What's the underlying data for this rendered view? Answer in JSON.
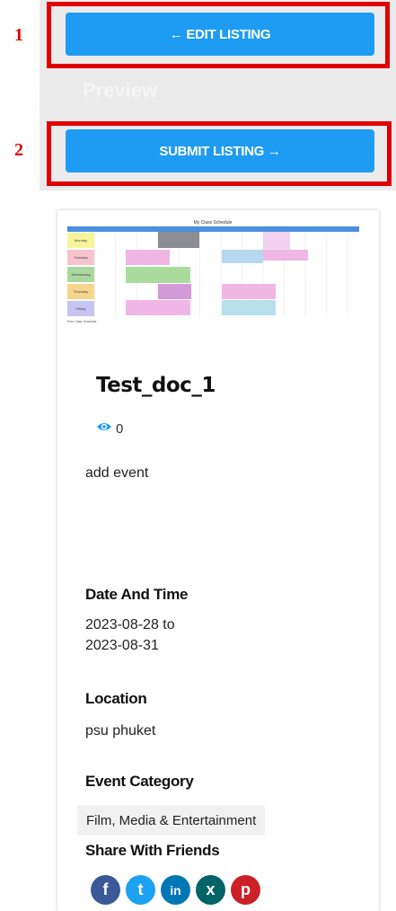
{
  "markers": {
    "first": "1",
    "second": "2"
  },
  "toolbar": {
    "edit_label": "← EDIT LISTING",
    "preview_label": "Preview",
    "submit_label": "SUBMIT LISTING →"
  },
  "listing": {
    "title": "Test_doc_1",
    "views": "0",
    "description": "add event",
    "date_heading": "Date And Time",
    "date_start": "2023-08-28 to",
    "date_end": "2023-08-31",
    "location_heading": "Location",
    "location": "psu phuket",
    "category_heading": "Event Category",
    "category": "Film, Media & Entertainment",
    "share_heading": "Share With Friends"
  },
  "thumbnail": {
    "title": "My Class Schedule",
    "days": [
      "Monday",
      "Tuesday",
      "Wednesday",
      "Thursday",
      "Friday"
    ],
    "day_colors": [
      "#f7f59a",
      "#f6c3cf",
      "#a9d89f",
      "#f7d58a",
      "#c9c3f2"
    ],
    "footer": "Free Class Schedule"
  },
  "share": {
    "icons": [
      "facebook-icon",
      "twitter-icon",
      "linkedin-icon",
      "xing-icon",
      "pinterest-icon"
    ],
    "colors": [
      "#3b5998",
      "#1da1f2",
      "#0077b5",
      "#026466",
      "#cb2027"
    ],
    "glyphs": [
      "f",
      "t",
      "in",
      "x",
      "p"
    ]
  },
  "colors": {
    "accent": "#1e9bf3",
    "highlight": "#e10000",
    "panel": "#ebebeb"
  }
}
